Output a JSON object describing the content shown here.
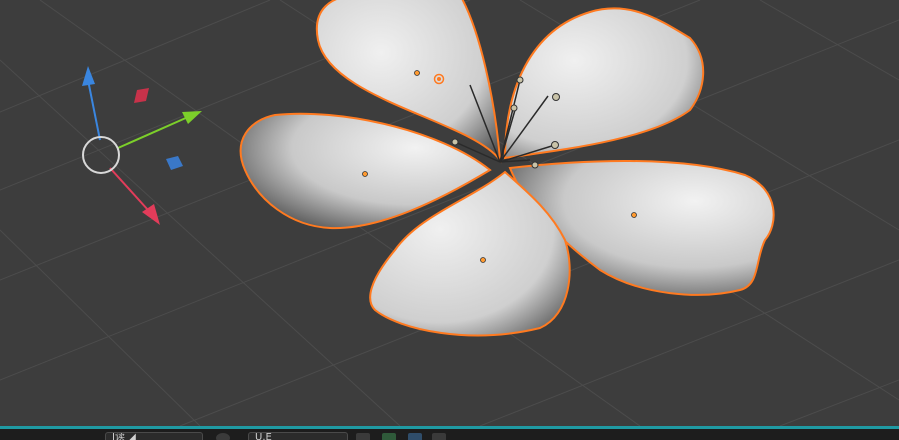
{
  "viewport": {
    "background": "#3d3d3d",
    "grid_color": "#4c4c4c",
    "selection_outline": "#ff7a20",
    "origin_dot": "#ff9a30",
    "petal_count": 5
  },
  "gizmo": {
    "z_axis_color": "#3a86e0",
    "y_axis_color": "#7ccf2a",
    "x_axis_color": "#e23c5a",
    "ring_color": "#d8d8d8",
    "plane_xz_color": "#c8324a",
    "plane_xy_color": "#3a78c8"
  },
  "footer": {
    "accent": "#1f9aa3",
    "field_1_text": "Ⅰ读 ◢",
    "field_2_text": "U.E",
    "icons": [
      "view-icon",
      "overlay-icon",
      "shading-icon",
      "render-icon",
      "snap-icon"
    ]
  }
}
